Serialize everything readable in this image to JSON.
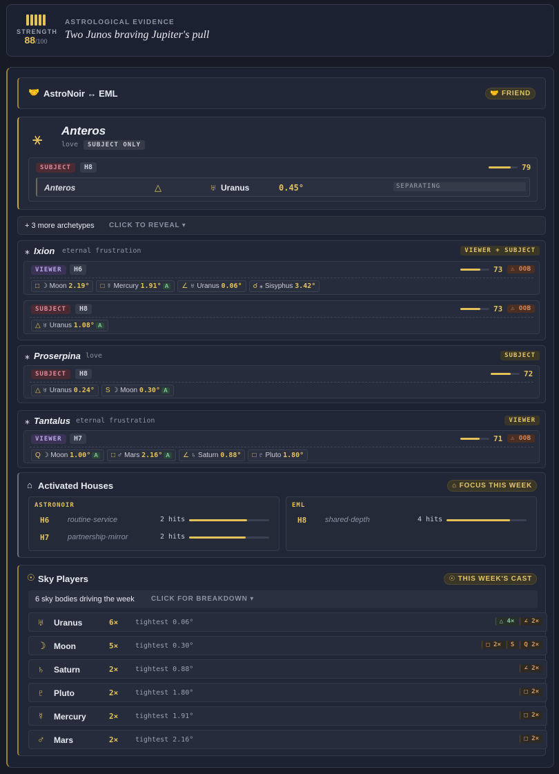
{
  "header": {
    "strength_label": "STRENGTH",
    "strength_value": "88",
    "strength_max": "/100",
    "evidence_label": "ASTROLOGICAL EVIDENCE",
    "evidence_title": "Two Junos braving Jupiter's pull"
  },
  "relation": {
    "title": "AstroNoir ↔ EML",
    "icon": "🤝",
    "badge": "🤝 FRIEND"
  },
  "anteros": {
    "name": "Anteros",
    "theme": "love",
    "scope": "SUBJECT ONLY",
    "side_tag": "SUBJECT",
    "house": "H8",
    "score": "79",
    "score_fraction": 0.79,
    "row": {
      "body": "Anteros",
      "aspect": "△",
      "planet_glyph": "♅",
      "planet": "Uranus",
      "orb": "0.45°",
      "state": "SEPARATING"
    }
  },
  "more": {
    "text": "+ 3 more archetypes",
    "action": "CLICK TO REVEAL ▾"
  },
  "ixion": {
    "name": "Ixion",
    "theme": "eternal frustration",
    "badge": "VIEWER + SUBJECT",
    "viewer": {
      "tag": "VIEWER",
      "house": "H6",
      "score": "73",
      "oob": "⚠ OOB",
      "chips": [
        {
          "asp": "□",
          "glyph": "☽",
          "planet": "Moon",
          "orb": "2.19°",
          "a": ""
        },
        {
          "asp": "□",
          "glyph": "☿",
          "planet": "Mercury",
          "orb": "1.91°",
          "a": "A"
        },
        {
          "asp": "∠",
          "glyph": "♅",
          "planet": "Uranus",
          "orb": "0.06°",
          "a": ""
        },
        {
          "asp": "☌",
          "glyph": "⁎",
          "planet": "Sisyphus",
          "orb": "3.42°",
          "a": ""
        }
      ]
    },
    "subject": {
      "tag": "SUBJECT",
      "house": "H8",
      "score": "73",
      "oob": "⚠ OOB",
      "chips": [
        {
          "asp": "△",
          "glyph": "♅",
          "planet": "Uranus",
          "orb": "1.08°",
          "a": "A"
        }
      ]
    }
  },
  "proserpina": {
    "name": "Proserpina",
    "theme": "love",
    "badge": "SUBJECT",
    "subject": {
      "tag": "SUBJECT",
      "house": "H8",
      "score": "72",
      "chips": [
        {
          "asp": "△",
          "glyph": "♅",
          "planet": "Uranus",
          "orb": "0.24°",
          "a": ""
        },
        {
          "asp": "S",
          "glyph": "☽",
          "planet": "Moon",
          "orb": "0.30°",
          "a": "A"
        }
      ]
    }
  },
  "tantalus": {
    "name": "Tantalus",
    "theme": "eternal frustration",
    "badge": "VIEWER",
    "viewer": {
      "tag": "VIEWER",
      "house": "H7",
      "score": "71",
      "oob": "⚠ OOB",
      "chips": [
        {
          "asp": "Q",
          "glyph": "☽",
          "planet": "Moon",
          "orb": "1.00°",
          "a": "A"
        },
        {
          "asp": "□",
          "glyph": "♂",
          "planet": "Mars",
          "orb": "2.16°",
          "a": "A"
        },
        {
          "asp": "∠",
          "glyph": "♄",
          "planet": "Saturn",
          "orb": "0.88°",
          "a": ""
        },
        {
          "asp": "□",
          "glyph": "♇",
          "planet": "Pluto",
          "orb": "1.80°",
          "a": ""
        }
      ]
    }
  },
  "houses": {
    "title": "Activated Houses",
    "badge": "⌂ FOCUS THIS WEEK",
    "left": {
      "label": "ASTRONOIR",
      "rows": [
        {
          "house": "H6",
          "name": "routine·service",
          "hits": "2 hits",
          "fill": 0.72
        },
        {
          "house": "H7",
          "name": "partnership·mirror",
          "hits": "2 hits",
          "fill": 0.71
        }
      ]
    },
    "right": {
      "label": "EML",
      "rows": [
        {
          "house": "H8",
          "name": "shared·depth",
          "hits": "4 hits",
          "fill": 0.79
        }
      ]
    }
  },
  "sky": {
    "title": "Sky Players",
    "badge": "☉ THIS WEEK'S CAST",
    "summary": "6 sky bodies driving the week",
    "action": "CLICK FOR BREAKDOWN ▾",
    "players": [
      {
        "glyph": "♅",
        "name": "Uranus",
        "count": "6×",
        "tight": "tightest 0.06°",
        "aspects": [
          {
            "t": "△ 4×",
            "g": true
          },
          {
            "t": "∠ 2×",
            "g": false
          }
        ]
      },
      {
        "glyph": "☽",
        "name": "Moon",
        "count": "5×",
        "tight": "tightest 0.30°",
        "aspects": [
          {
            "t": "□ 2×",
            "g": false
          },
          {
            "t": "S",
            "g": false
          },
          {
            "t": "Q 2×",
            "g": false
          }
        ]
      },
      {
        "glyph": "♄",
        "name": "Saturn",
        "count": "2×",
        "tight": "tightest 0.88°",
        "aspects": [
          {
            "t": "∠ 2×",
            "g": false
          }
        ]
      },
      {
        "glyph": "♇",
        "name": "Pluto",
        "count": "2×",
        "tight": "tightest 1.80°",
        "aspects": [
          {
            "t": "□ 2×",
            "g": false
          }
        ]
      },
      {
        "glyph": "☿",
        "name": "Mercury",
        "count": "2×",
        "tight": "tightest 1.91°",
        "aspects": [
          {
            "t": "□ 2×",
            "g": false
          }
        ]
      },
      {
        "glyph": "♂",
        "name": "Mars",
        "count": "2×",
        "tight": "tightest 2.16°",
        "aspects": [
          {
            "t": "□ 2×",
            "g": false
          }
        ]
      }
    ]
  }
}
